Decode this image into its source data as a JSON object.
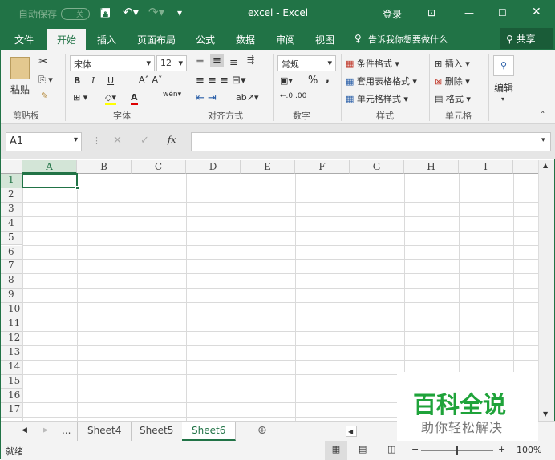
{
  "title_bar": {
    "autosave": "自动保存",
    "autosave_state": "关",
    "title": "excel  -  Excel",
    "login": "登录"
  },
  "tabs": [
    "文件",
    "开始",
    "插入",
    "页面布局",
    "公式",
    "数据",
    "审阅",
    "视图"
  ],
  "active_tab": "开始",
  "tell_me": "告诉我你想要做什么",
  "share": "共享",
  "ribbon": {
    "clipboard": {
      "paste": "粘贴",
      "label": "剪贴板"
    },
    "font": {
      "name": "宋体",
      "size": "12",
      "bold": "B",
      "italic": "I",
      "underline": "U",
      "label": "字体"
    },
    "alignment": {
      "label": "对齐方式"
    },
    "number": {
      "format": "常规",
      "percent": "%",
      "comma": ",",
      "label": "数字"
    },
    "styles": {
      "conditional": "条件格式",
      "table": "套用表格格式",
      "cell": "单元格样式",
      "label": "样式"
    },
    "cells": {
      "insert": "插入",
      "delete": "删除",
      "format": "格式",
      "label": "单元格"
    },
    "editing": {
      "label": "编辑"
    }
  },
  "formula_bar": {
    "name_box": "A1",
    "fx": "fx",
    "value": ""
  },
  "columns": [
    "A",
    "B",
    "C",
    "D",
    "E",
    "F",
    "G",
    "H",
    "I"
  ],
  "rows": [
    "1",
    "2",
    "3",
    "4",
    "5",
    "6",
    "7",
    "8",
    "9",
    "10",
    "11",
    "12",
    "13",
    "14",
    "15",
    "16",
    "17"
  ],
  "selected_cell": "A1",
  "sheets": [
    "Sheet4",
    "Sheet5",
    "Sheet6"
  ],
  "active_sheet": "Sheet6",
  "ellipsis": "...",
  "status": {
    "ready": "就绪",
    "zoom": "100%"
  },
  "watermark": {
    "brand": "百科全说",
    "slogan": "助你轻松解决"
  },
  "colors": {
    "accent": "#217346"
  }
}
